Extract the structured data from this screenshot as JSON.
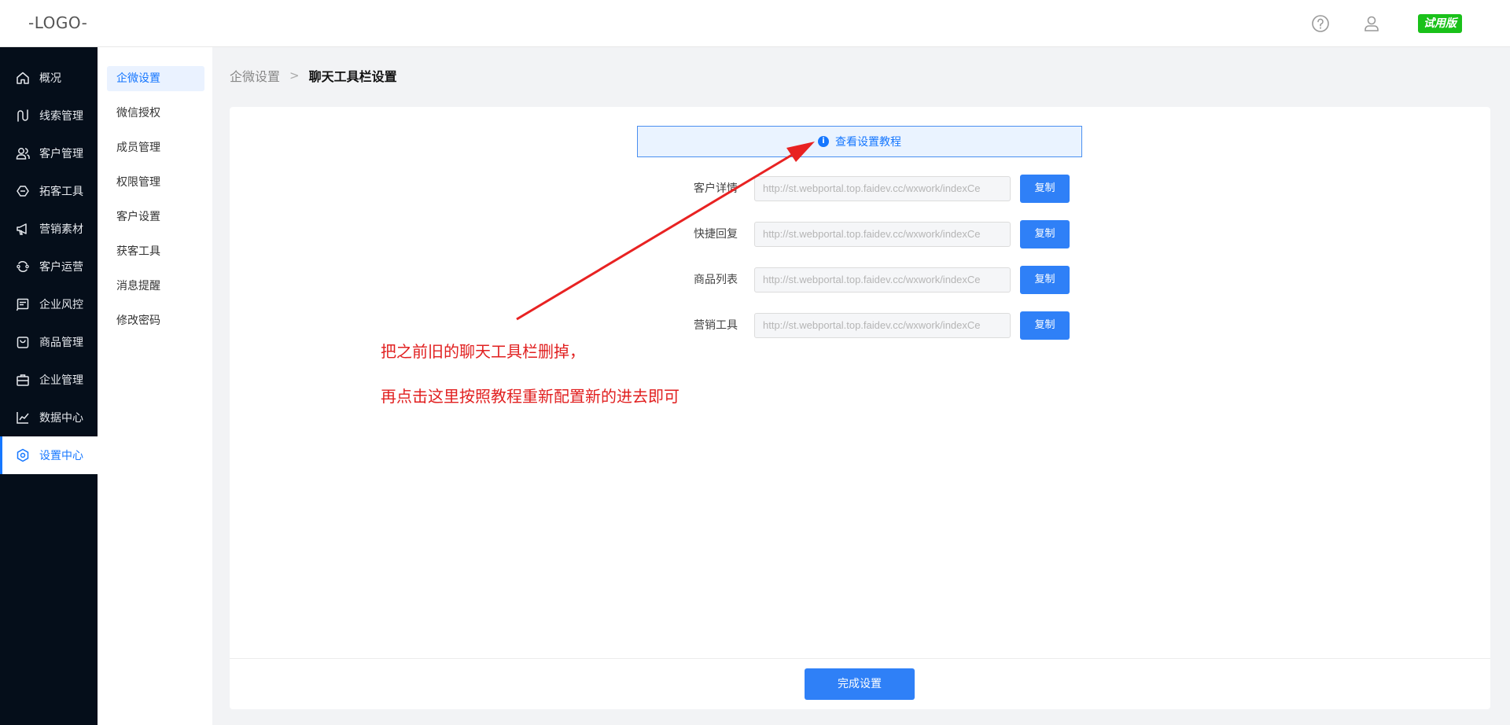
{
  "header": {
    "logo": "-LOGO-",
    "help_icon": "help-circle-icon",
    "user_icon": "user-icon",
    "trial_badge": "试用版",
    "trial_color": "#1ac11a"
  },
  "sidebar": {
    "items": [
      {
        "label": "概况",
        "icon": "home-icon"
      },
      {
        "label": "线索管理",
        "icon": "route-icon"
      },
      {
        "label": "客户管理",
        "icon": "users-icon"
      },
      {
        "label": "拓客工具",
        "icon": "shield-tag-icon"
      },
      {
        "label": "营销素材",
        "icon": "megaphone-icon"
      },
      {
        "label": "客户运营",
        "icon": "cycle-icon"
      },
      {
        "label": "企业风控",
        "icon": "document-icon"
      },
      {
        "label": "商品管理",
        "icon": "shopping-bag-icon"
      },
      {
        "label": "企业管理",
        "icon": "briefcase-icon"
      },
      {
        "label": "数据中心",
        "icon": "chart-line-icon"
      },
      {
        "label": "设置中心",
        "icon": "settings-icon",
        "active": true
      }
    ]
  },
  "submenu": {
    "items": [
      {
        "label": "企微设置",
        "active": true
      },
      {
        "label": "微信授权"
      },
      {
        "label": "成员管理"
      },
      {
        "label": "权限管理"
      },
      {
        "label": "客户设置"
      },
      {
        "label": "获客工具"
      },
      {
        "label": "消息提醒"
      },
      {
        "label": "修改密码"
      }
    ]
  },
  "breadcrumb": {
    "parent": "企微设置",
    "separator": ">",
    "current": "聊天工具栏设置"
  },
  "main": {
    "tutorial_link": "查看设置教程",
    "rows": [
      {
        "label": "客户详情",
        "url": "http://st.webportal.top.faidev.cc/wxwork/indexCe",
        "copy": "复制"
      },
      {
        "label": "快捷回复",
        "url": "http://st.webportal.top.faidev.cc/wxwork/indexCe",
        "copy": "复制"
      },
      {
        "label": "商品列表",
        "url": "http://st.webportal.top.faidev.cc/wxwork/indexCe",
        "copy": "复制"
      },
      {
        "label": "营销工具",
        "url": "http://st.webportal.top.faidev.cc/wxwork/indexCe",
        "copy": "复制"
      }
    ],
    "finish_button": "完成设置",
    "accent_color": "#2f80f7"
  },
  "annotation": {
    "line1": "把之前旧的聊天工具栏删掉，",
    "line2": "再点击这里按照教程重新配置新的进去即可",
    "color": "#e12020"
  }
}
